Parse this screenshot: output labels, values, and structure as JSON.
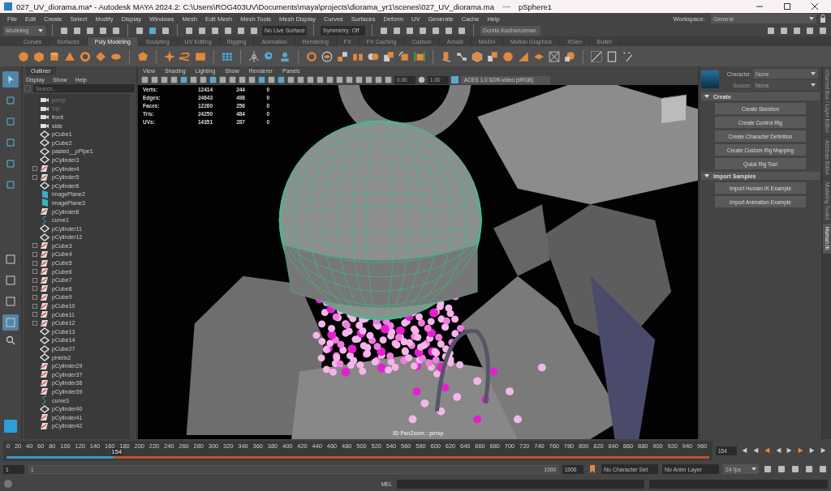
{
  "window": {
    "title": "027_UV_diorama.ma* - Autodesk MAYA 2024.2: C:\\Users\\ROG403UV\\Documents\\maya\\projects\\diorama_yr1\\scenes\\027_UV_diorama.ma",
    "selection": "pSphere1"
  },
  "menus": [
    "File",
    "Edit",
    "Create",
    "Select",
    "Modify",
    "Display",
    "Windows",
    "Mesh",
    "Edit Mesh",
    "Mesh Tools",
    "Mesh Display",
    "Curves",
    "Surfaces",
    "Deform",
    "UV",
    "Generate",
    "Cache",
    "Help"
  ],
  "workspace": {
    "label": "Workspace:",
    "value": "General"
  },
  "status_line": {
    "mode": "Modeling",
    "live_surface": "No Live Surface",
    "symmetry": "Symmetry: Off",
    "user": "Donita Kadharusman"
  },
  "shelf_tabs": [
    {
      "label": "Curves",
      "selected": false
    },
    {
      "label": "Surfaces",
      "selected": false
    },
    {
      "label": "Poly Modeling",
      "selected": true
    },
    {
      "label": "Sculpting",
      "selected": false
    },
    {
      "label": "UV Editing",
      "selected": false
    },
    {
      "label": "Rigging",
      "selected": false
    },
    {
      "label": "Animation",
      "selected": false
    },
    {
      "label": "Rendering",
      "selected": false
    },
    {
      "label": "FX",
      "selected": false
    },
    {
      "label": "FX Caching",
      "selected": false
    },
    {
      "label": "Custom",
      "selected": false
    },
    {
      "label": "Arnold",
      "selected": false
    },
    {
      "label": "MASH",
      "selected": false
    },
    {
      "label": "Motion Graphics",
      "selected": false
    },
    {
      "label": "XGen",
      "selected": false
    },
    {
      "label": "Bullet",
      "selected": false
    }
  ],
  "outliner": {
    "title": "Outliner",
    "menus": [
      "Display",
      "Show",
      "Help"
    ],
    "placeholder": "Search...",
    "items": [
      {
        "name": "persp",
        "kind": "camera",
        "expandable": false,
        "hidden": true
      },
      {
        "name": "top",
        "kind": "camera",
        "expandable": false,
        "hidden": true
      },
      {
        "name": "front",
        "kind": "camera",
        "expandable": false,
        "hidden": false
      },
      {
        "name": "side",
        "kind": "camera",
        "expandable": false,
        "hidden": false
      },
      {
        "name": "pCube1",
        "kind": "mesh",
        "expandable": false,
        "hidden": false
      },
      {
        "name": "pCube2",
        "kind": "mesh",
        "expandable": false,
        "hidden": false
      },
      {
        "name": "pasted__pPipe1",
        "kind": "mesh",
        "expandable": false,
        "hidden": false
      },
      {
        "name": "pCylinder3",
        "kind": "mesh",
        "expandable": false,
        "hidden": false
      },
      {
        "name": "pCylinder4",
        "kind": "group",
        "expandable": true,
        "hidden": false
      },
      {
        "name": "pCylinder5",
        "kind": "group",
        "expandable": true,
        "hidden": false
      },
      {
        "name": "pCylinder6",
        "kind": "mesh",
        "expandable": false,
        "hidden": false
      },
      {
        "name": "imagePlane2",
        "kind": "image_plane",
        "expandable": false,
        "hidden": false
      },
      {
        "name": "imagePlane3",
        "kind": "image_plane",
        "expandable": false,
        "hidden": false
      },
      {
        "name": "pCylinder8",
        "kind": "group",
        "expandable": false,
        "hidden": false
      },
      {
        "name": "curve1",
        "kind": "curve",
        "expandable": false,
        "hidden": false
      },
      {
        "name": "pCylinder11",
        "kind": "mesh",
        "expandable": false,
        "hidden": false
      },
      {
        "name": "pCylinder12",
        "kind": "mesh",
        "expandable": false,
        "hidden": false
      },
      {
        "name": "pCube3",
        "kind": "group",
        "expandable": true,
        "hidden": false
      },
      {
        "name": "pCube4",
        "kind": "group",
        "expandable": true,
        "hidden": false
      },
      {
        "name": "pCube5",
        "kind": "group",
        "expandable": true,
        "hidden": false
      },
      {
        "name": "pCube6",
        "kind": "group",
        "expandable": true,
        "hidden": false
      },
      {
        "name": "pCube7",
        "kind": "group",
        "expandable": true,
        "hidden": false
      },
      {
        "name": "pCube8",
        "kind": "group",
        "expandable": true,
        "hidden": false
      },
      {
        "name": "pCube9",
        "kind": "group",
        "expandable": true,
        "hidden": false
      },
      {
        "name": "pCube10",
        "kind": "group",
        "expandable": true,
        "hidden": false
      },
      {
        "name": "pCube11",
        "kind": "group",
        "expandable": true,
        "hidden": false
      },
      {
        "name": "pCube12",
        "kind": "group",
        "expandable": true,
        "hidden": false
      },
      {
        "name": "pCube13",
        "kind": "mesh",
        "expandable": false,
        "hidden": false
      },
      {
        "name": "pCube14",
        "kind": "mesh",
        "expandable": false,
        "hidden": false
      },
      {
        "name": "pCube27",
        "kind": "mesh",
        "expandable": false,
        "hidden": false
      },
      {
        "name": "pHelix2",
        "kind": "mesh",
        "expandable": false,
        "hidden": false
      },
      {
        "name": "pCylinder29",
        "kind": "group",
        "expandable": false,
        "hidden": false
      },
      {
        "name": "pCylinder37",
        "kind": "group",
        "expandable": false,
        "hidden": false
      },
      {
        "name": "pCylinder38",
        "kind": "group",
        "expandable": false,
        "hidden": false
      },
      {
        "name": "pCylinder39",
        "kind": "group",
        "expandable": false,
        "hidden": false
      },
      {
        "name": "curve3",
        "kind": "curve",
        "expandable": false,
        "hidden": false
      },
      {
        "name": "pCylinder40",
        "kind": "mesh",
        "expandable": false,
        "hidden": false
      },
      {
        "name": "pCylinder41",
        "kind": "group",
        "expandable": false,
        "hidden": false
      },
      {
        "name": "pCylinder42",
        "kind": "group",
        "expandable": false,
        "hidden": false
      }
    ]
  },
  "viewport": {
    "menus": [
      "View",
      "Shading",
      "Lighting",
      "Show",
      "Renderer",
      "Panels"
    ],
    "exposure": "0.00",
    "gamma": "1.00",
    "color_space": "ACES 1.0 SDR-video (sRGB)",
    "hud": [
      {
        "label": "Verts:",
        "values": [
          "12414",
          "244",
          "0"
        ]
      },
      {
        "label": "Edges:",
        "values": [
          "24643",
          "498",
          "0"
        ]
      },
      {
        "label": "Faces:",
        "values": [
          "12260",
          "256",
          "0"
        ]
      },
      {
        "label": "Tris:",
        "values": [
          "24250",
          "484",
          "0"
        ]
      },
      {
        "label": "UVs:",
        "values": [
          "14351",
          "287",
          "0"
        ]
      }
    ],
    "camera_label": "3D PanZoom : persp"
  },
  "human_ik": {
    "character_label": "Character:",
    "character": "None",
    "source_label": "Source:",
    "source": "None",
    "sections": [
      {
        "title": "Create",
        "expanded": true,
        "buttons": [
          "Create Skeleton",
          "Create Control Rig",
          "Create Character Definition",
          "Create Custom Rig Mapping",
          "Quick Rig Tool"
        ]
      },
      {
        "title": "Import Samples",
        "expanded": true,
        "buttons": [
          "Import Human IK Example",
          "Import Animation Example"
        ]
      }
    ]
  },
  "side_tabs": [
    {
      "label": "Channel Box / Layer Editor",
      "selected": false
    },
    {
      "label": "Attribute Editor",
      "selected": false
    },
    {
      "label": "Modeling Toolkit",
      "selected": false
    },
    {
      "label": "Human IK",
      "selected": true
    }
  ],
  "timeline": {
    "ticks": [
      "0",
      "20",
      "40",
      "60",
      "80",
      "100",
      "120",
      "140",
      "160",
      "180",
      "200",
      "220",
      "240",
      "260",
      "280",
      "300",
      "320",
      "340",
      "360",
      "380",
      "400",
      "420",
      "440",
      "460",
      "480",
      "500",
      "520",
      "540",
      "560",
      "580",
      "600",
      "620",
      "640",
      "660",
      "680",
      "700",
      "720",
      "740",
      "760",
      "780",
      "800",
      "820",
      "840",
      "860",
      "880",
      "900",
      "920",
      "940",
      "960"
    ],
    "current": "154",
    "current_field": "154",
    "level": 0.154
  },
  "range": {
    "start": "1",
    "inner_start": "1",
    "inner_end": "1000",
    "end": "1000",
    "character_set": "No Character Set",
    "anim_layer": "No Anim Layer",
    "fps": "24 fps",
    "level": 1
  },
  "command_line": {
    "language": "MEL"
  }
}
